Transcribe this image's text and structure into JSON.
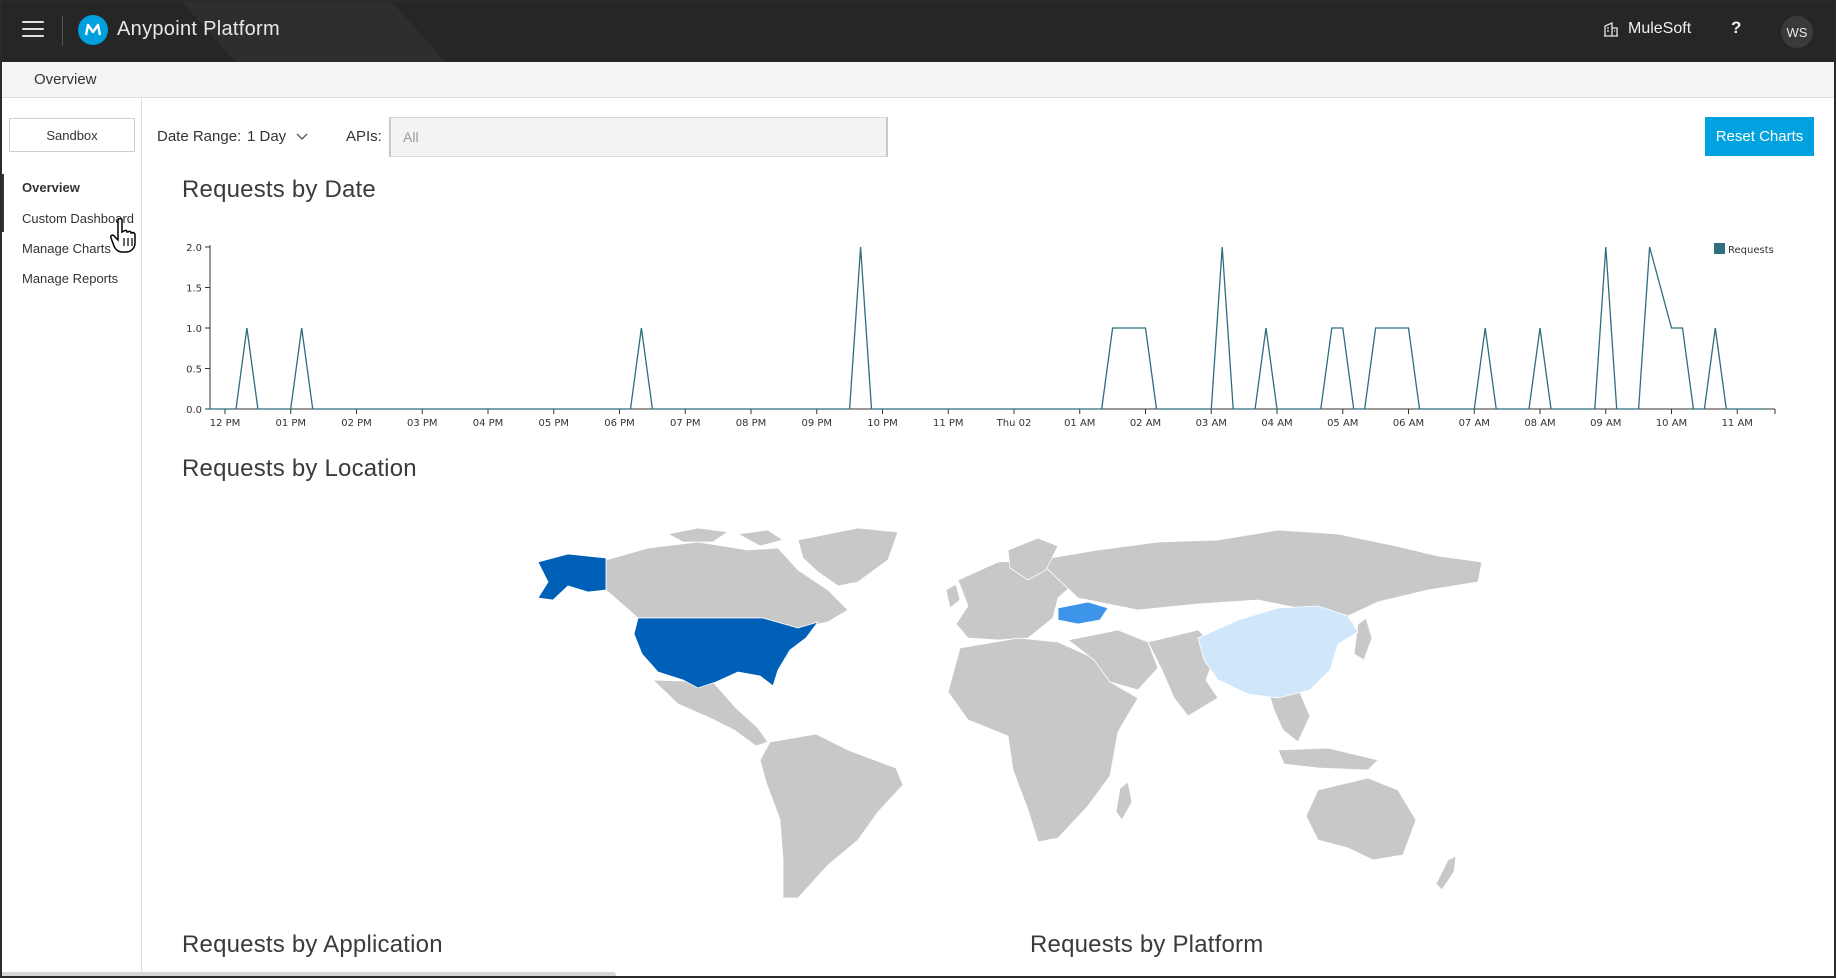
{
  "app": {
    "title": "Anypoint Platform",
    "org": "MuleSoft",
    "help": "?",
    "user_initials": "WS"
  },
  "breadcrumb": "Overview",
  "sidebar": {
    "environment": "Sandbox",
    "items": [
      {
        "label": "Overview",
        "active": true
      },
      {
        "label": "Custom Dashboard",
        "active": false
      },
      {
        "label": "Manage Charts",
        "active": false
      },
      {
        "label": "Manage Reports",
        "active": false
      }
    ]
  },
  "filters": {
    "date_range_label": "Date Range:",
    "date_range_value": "1 Day",
    "apis_label": "APIs:",
    "apis_placeholder": "All",
    "reset_label": "Reset Charts"
  },
  "sections": {
    "requests_by_date": "Requests by Date",
    "requests_by_location": "Requests by Location",
    "requests_by_application": "Requests by Application",
    "requests_by_platform": "Requests by Platform"
  },
  "colors": {
    "accent": "#00a2df",
    "series": "#2e6e7e",
    "map_base": "#c8c8c8",
    "map_high": "#0060b8",
    "map_mid": "#3c95e8",
    "map_low": "#cfe6fb"
  },
  "map_highlights": [
    {
      "region": "United States",
      "level": "high"
    },
    {
      "region": "Ukraine",
      "level": "mid"
    },
    {
      "region": "China",
      "level": "low"
    }
  ],
  "chart_data": {
    "type": "line",
    "title": "Requests by Date",
    "series": [
      {
        "name": "Requests"
      }
    ],
    "ylim": [
      0,
      2
    ],
    "yticks": [
      "0.0",
      "0.5",
      "1.0",
      "1.5",
      "2.0"
    ],
    "xticks": [
      "12 PM",
      "01 PM",
      "02 PM",
      "03 PM",
      "04 PM",
      "05 PM",
      "06 PM",
      "07 PM",
      "08 PM",
      "09 PM",
      "10 PM",
      "11 PM",
      "Thu 02",
      "01 AM",
      "02 AM",
      "03 AM",
      "04 AM",
      "05 AM",
      "06 AM",
      "07 AM",
      "08 AM",
      "09 AM",
      "10 AM",
      "11 AM"
    ],
    "points": [
      {
        "t": "12:20 PM",
        "y": 1
      },
      {
        "t": "01:10 PM",
        "y": 1
      },
      {
        "t": "06:20 PM",
        "y": 1
      },
      {
        "t": "09:40 PM",
        "y": 2
      },
      {
        "t": "01:30 AM",
        "y": 1
      },
      {
        "t": "01:50 AM",
        "y": 1
      },
      {
        "t": "02:00 AM",
        "y": 1
      },
      {
        "t": "03:10 AM",
        "y": 2
      },
      {
        "t": "03:50 AM",
        "y": 1
      },
      {
        "t": "04:50 AM",
        "y": 1
      },
      {
        "t": "05:00 AM",
        "y": 1
      },
      {
        "t": "05:30 AM",
        "y": 1
      },
      {
        "t": "05:40 AM",
        "y": 1
      },
      {
        "t": "06:00 AM",
        "y": 1
      },
      {
        "t": "07:10 AM",
        "y": 1
      },
      {
        "t": "08:00 AM",
        "y": 1
      },
      {
        "t": "09:00 AM",
        "y": 2
      },
      {
        "t": "09:40 AM",
        "y": 2
      },
      {
        "t": "10:00 AM",
        "y": 1
      },
      {
        "t": "10:10 AM",
        "y": 1
      },
      {
        "t": "10:40 AM",
        "y": 1
      }
    ],
    "legend": "top-right",
    "grid": false
  }
}
